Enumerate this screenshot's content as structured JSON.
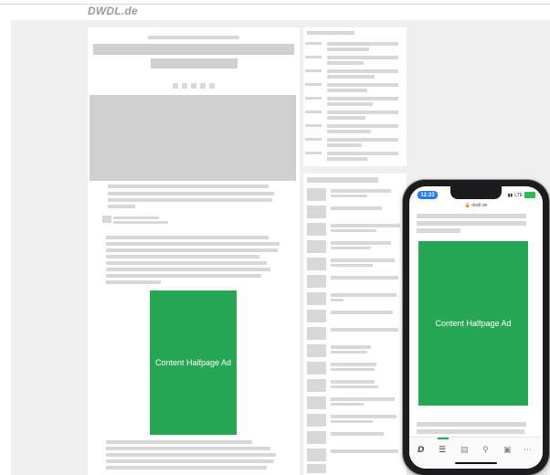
{
  "header": {
    "logo_text": "DWDL.de"
  },
  "ads": {
    "content_halfpage_label": "Content Halfpage Ad",
    "ad_color": "#27a654"
  },
  "phone": {
    "time": "12:23",
    "url": "dwdl.de",
    "carrier": "LTE",
    "tabs": [
      "D",
      "list-icon",
      "chart-icon",
      "search-icon",
      "bag-icon",
      "more-icon"
    ]
  }
}
